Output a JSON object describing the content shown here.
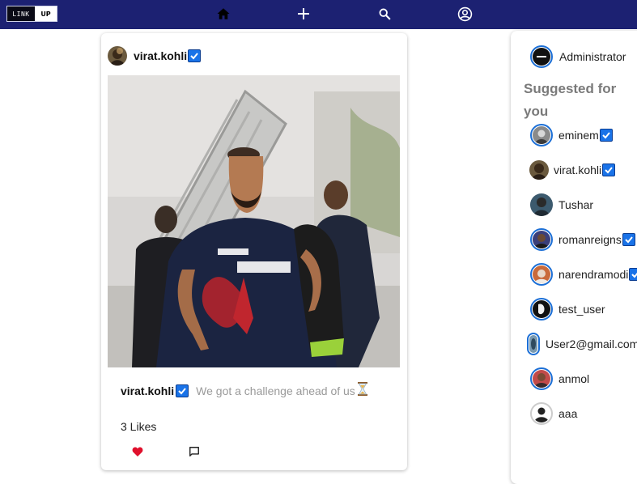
{
  "nav": {
    "logo_left": "LINK",
    "logo_right": "UP",
    "icons": [
      "home-icon",
      "add-icon",
      "search-icon",
      "account-icon"
    ],
    "bg": "#1c2172"
  },
  "post": {
    "username": "virat.kohli",
    "verified": true,
    "caption_user": "virat.kohli",
    "caption_text": "We got a challenge ahead of us",
    "caption_emoji": "hourglass-icon",
    "likes_text": "3 Likes",
    "liked": true,
    "like_color": "#e0102c"
  },
  "sidebar": {
    "current_user": "Administrator",
    "suggested_title": "Suggested for you",
    "suggestions": [
      {
        "name": "eminem",
        "verified": true
      },
      {
        "name": "virat.kohli",
        "verified": true
      },
      {
        "name": "Tushar",
        "verified": false
      },
      {
        "name": "romanreigns",
        "verified": true
      },
      {
        "name": "narendramodi",
        "verified": true
      },
      {
        "name": "test_user",
        "verified": false
      },
      {
        "name": "User2@gmail.com",
        "verified": false
      },
      {
        "name": "anmol",
        "verified": false
      },
      {
        "name": "aaa",
        "verified": false
      }
    ],
    "ring_color": "#1c6fd6",
    "verified_color": "#1a73e8"
  }
}
